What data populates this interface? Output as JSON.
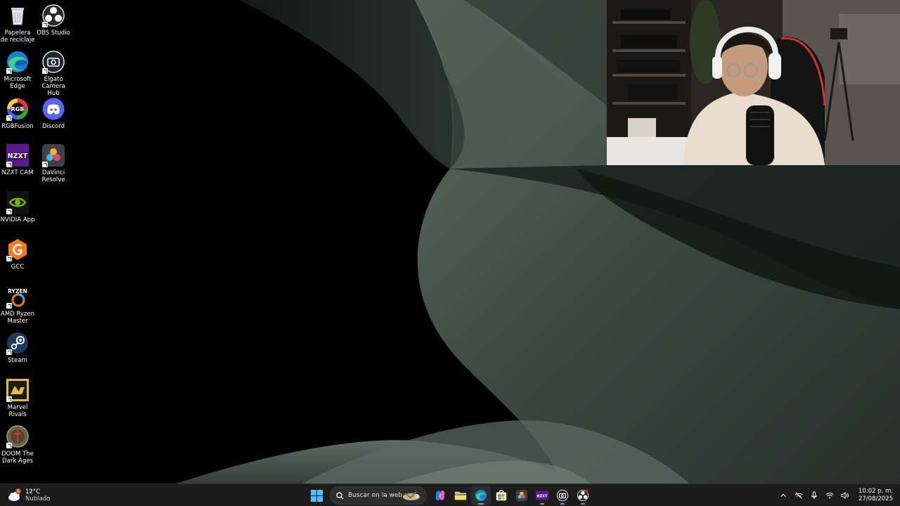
{
  "desktop": {
    "icons": [
      {
        "label": "Papelera de reciclaje",
        "icon": "recycle-bin-icon"
      },
      {
        "label": "OBS Studio",
        "icon": "obs-studio-icon"
      },
      {
        "label": "Microsoft Edge",
        "icon": "edge-icon"
      },
      {
        "label": "Elgato Camera Hub",
        "icon": "elgato-camera-icon"
      },
      {
        "label": "RGBFusion",
        "icon": "rgbfusion-icon"
      },
      {
        "label": "Discord",
        "icon": "discord-icon"
      },
      {
        "label": "NZXT CAM",
        "icon": "nzxt-cam-icon"
      },
      {
        "label": "DaVinci Resolve",
        "icon": "davinci-resolve-icon"
      },
      {
        "label": "NVIDIA App",
        "icon": "nvidia-icon"
      },
      {
        "label": "GCC",
        "icon": "gcc-icon"
      },
      {
        "label": "AMD Ryzen Master",
        "icon": "amd-ryzen-icon"
      },
      {
        "label": "Steam",
        "icon": "steam-icon"
      },
      {
        "label": "Marvel Rivals",
        "icon": "marvel-rivals-icon"
      },
      {
        "label": "DOOM The Dark Ages",
        "icon": "doom-icon"
      }
    ],
    "icon_text": {
      "rgb": "RGB",
      "nzxt": "NZXT",
      "ryzen": "RYZEN"
    }
  },
  "webcam": {
    "icon": "webcam-overlay"
  },
  "taskbar": {
    "weather": {
      "temp": "12°C",
      "condition": "Nublado",
      "badge": "9",
      "icon": "cloud-icon"
    },
    "search": {
      "placeholder": "Buscar en la web...",
      "icon": "search-icon"
    },
    "nzxt_label": "NZXT",
    "apps": [
      "start-icon",
      "copilot-icon",
      "file-explorer-icon",
      "edge-icon",
      "store-icon",
      "davinci-resolve-icon",
      "nzxt-cam-icon",
      "elgato-camera-icon",
      "obs-studio-icon"
    ],
    "tray": [
      "chevron-up-icon",
      "network-off-icon",
      "microphone-icon",
      "wifi-icon",
      "speaker-icon"
    ],
    "clock": {
      "time": "10:02 p. m.",
      "date": "27/08/2025"
    }
  }
}
